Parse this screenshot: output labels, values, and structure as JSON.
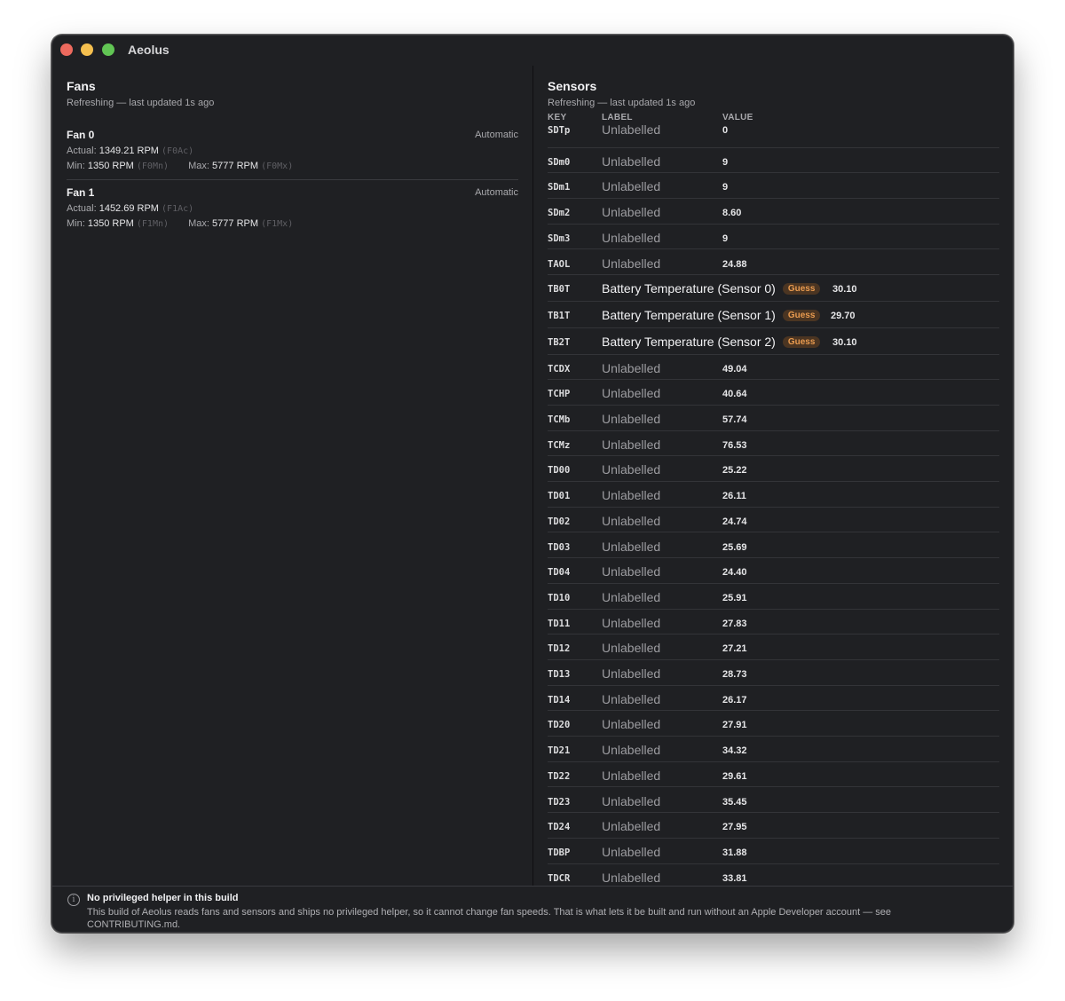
{
  "window": {
    "title": "Aeolus"
  },
  "fans": {
    "title": "Fans",
    "status": "Refreshing — last updated 1s ago",
    "items": [
      {
        "name": "Fan 0",
        "mode": "Automatic",
        "actual_label": "Actual:",
        "actual": "1349.21 RPM",
        "actual_key": "(F0Ac)",
        "min_label": "Min:",
        "min": "1350 RPM",
        "min_key": "(F0Mn)",
        "max_label": "Max:",
        "max": "5777 RPM",
        "max_key": "(F0Mx)"
      },
      {
        "name": "Fan 1",
        "mode": "Automatic",
        "actual_label": "Actual:",
        "actual": "1452.69 RPM",
        "actual_key": "(F1Ac)",
        "min_label": "Min:",
        "min": "1350 RPM",
        "min_key": "(F1Mn)",
        "max_label": "Max:",
        "max": "5777 RPM",
        "max_key": "(F1Mx)"
      }
    ]
  },
  "sensors": {
    "title": "Sensors",
    "status": "Refreshing — last updated 1s ago",
    "columns": {
      "key": "KEY",
      "label": "LABEL",
      "value": "VALUE"
    },
    "rows": [
      {
        "key": "SDTp",
        "label": "Unlabelled",
        "value": "0"
      },
      {
        "key": "SDm0",
        "label": "Unlabelled",
        "value": "9"
      },
      {
        "key": "SDm1",
        "label": "Unlabelled",
        "value": "9"
      },
      {
        "key": "SDm2",
        "label": "Unlabelled",
        "value": "8.60"
      },
      {
        "key": "SDm3",
        "label": "Unlabelled",
        "value": "9"
      },
      {
        "key": "TAOL",
        "label": "Unlabelled",
        "value": "24.88"
      },
      {
        "key": "TB0T",
        "label": "Battery Temperature (Sensor 0)",
        "badge": "Guess",
        "value": "30.10"
      },
      {
        "key": "TB1T",
        "label": "Battery Temperature (Sensor 1)",
        "badge": "Guess",
        "value": "29.70"
      },
      {
        "key": "TB2T",
        "label": "Battery Temperature (Sensor 2)",
        "badge": "Guess",
        "value": "30.10"
      },
      {
        "key": "TCDX",
        "label": "Unlabelled",
        "value": "49.04"
      },
      {
        "key": "TCHP",
        "label": "Unlabelled",
        "value": "40.64"
      },
      {
        "key": "TCMb",
        "label": "Unlabelled",
        "value": "57.74"
      },
      {
        "key": "TCMz",
        "label": "Unlabelled",
        "value": "76.53"
      },
      {
        "key": "TD00",
        "label": "Unlabelled",
        "value": "25.22"
      },
      {
        "key": "TD01",
        "label": "Unlabelled",
        "value": "26.11"
      },
      {
        "key": "TD02",
        "label": "Unlabelled",
        "value": "24.74"
      },
      {
        "key": "TD03",
        "label": "Unlabelled",
        "value": "25.69"
      },
      {
        "key": "TD04",
        "label": "Unlabelled",
        "value": "24.40"
      },
      {
        "key": "TD10",
        "label": "Unlabelled",
        "value": "25.91"
      },
      {
        "key": "TD11",
        "label": "Unlabelled",
        "value": "27.83"
      },
      {
        "key": "TD12",
        "label": "Unlabelled",
        "value": "27.21"
      },
      {
        "key": "TD13",
        "label": "Unlabelled",
        "value": "28.73"
      },
      {
        "key": "TD14",
        "label": "Unlabelled",
        "value": "26.17"
      },
      {
        "key": "TD20",
        "label": "Unlabelled",
        "value": "27.91"
      },
      {
        "key": "TD21",
        "label": "Unlabelled",
        "value": "34.32"
      },
      {
        "key": "TD22",
        "label": "Unlabelled",
        "value": "29.61"
      },
      {
        "key": "TD23",
        "label": "Unlabelled",
        "value": "35.45"
      },
      {
        "key": "TD24",
        "label": "Unlabelled",
        "value": "27.95"
      },
      {
        "key": "TDBP",
        "label": "Unlabelled",
        "value": "31.88"
      },
      {
        "key": "TDCR",
        "label": "Unlabelled",
        "value": "33.81"
      }
    ]
  },
  "footer": {
    "icon": "info-icon",
    "title": "No privileged helper in this build",
    "body": "This build of Aeolus reads fans and sensors and ships no privileged helper, so it cannot change fan speeds. That is what lets it be built and run without an Apple Developer account — see CONTRIBUTING.md."
  },
  "colors": {
    "window_bg": "#1f2023",
    "badge_text": "#e89a4f",
    "badge_bg": "#4b3522",
    "close": "#ed6a5e",
    "minimize": "#f5bf4f",
    "maximize": "#61c554"
  }
}
